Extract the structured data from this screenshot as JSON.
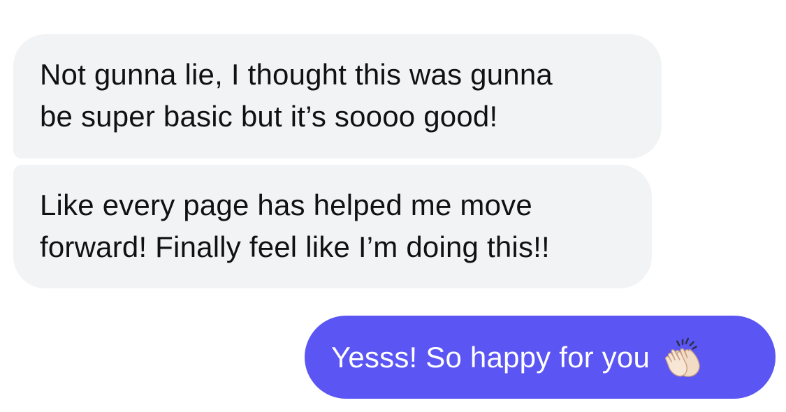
{
  "conversation": {
    "messages": [
      {
        "direction": "incoming",
        "lines": [
          "Not gunna lie, I thought this was gunna",
          "be super basic but it’s soooo good!"
        ]
      },
      {
        "direction": "incoming",
        "lines": [
          "Like every page has helped me move",
          "forward! Finally feel like I’m doing this!!"
        ]
      },
      {
        "direction": "outgoing",
        "text": "Yesss! So happy for you",
        "icon": "clapping-hands-icon"
      }
    ]
  },
  "colors": {
    "incoming_bubble": "#f2f3f5",
    "incoming_text": "#111111",
    "outgoing_bubble": "#5b56f3",
    "outgoing_text": "#ffffff"
  }
}
